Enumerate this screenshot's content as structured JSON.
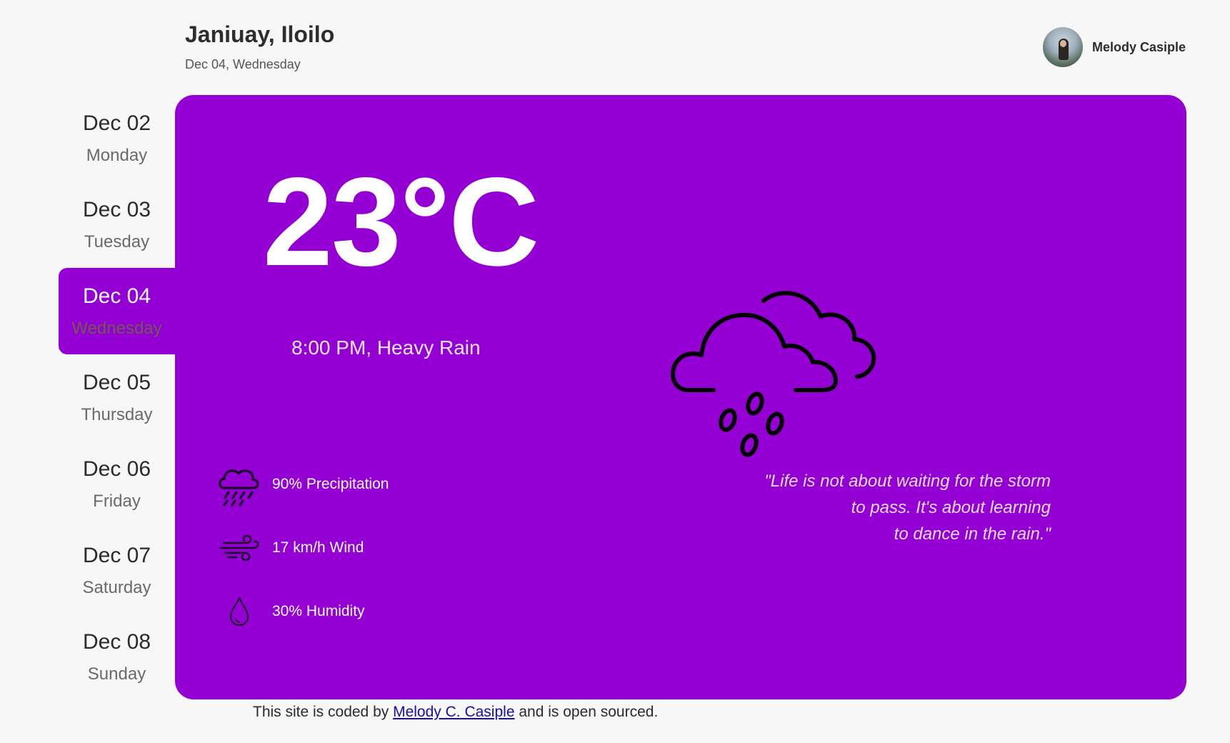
{
  "header": {
    "location": "Janiuay, Iloilo",
    "date": "Dec 04, Wednesday"
  },
  "user": {
    "name": "Melody Casiple"
  },
  "days": [
    {
      "date": "Dec 02",
      "weekday": "Monday",
      "active": false
    },
    {
      "date": "Dec 03",
      "weekday": "Tuesday",
      "active": false
    },
    {
      "date": "Dec 04",
      "weekday": "Wednesday",
      "active": true
    },
    {
      "date": "Dec 05",
      "weekday": "Thursday",
      "active": false
    },
    {
      "date": "Dec 06",
      "weekday": "Friday",
      "active": false
    },
    {
      "date": "Dec 07",
      "weekday": "Saturday",
      "active": false
    },
    {
      "date": "Dec 08",
      "weekday": "Sunday",
      "active": false
    }
  ],
  "weather": {
    "temperature": "23°C",
    "condition": "8:00 PM, Heavy Rain",
    "icon": "heavy-rain-cloud-icon",
    "stats": [
      {
        "icon": "rain-cloud-icon",
        "text": "90% Precipitation"
      },
      {
        "icon": "wind-icon",
        "text": "17 km/h Wind"
      },
      {
        "icon": "droplet-icon",
        "text": "30% Humidity"
      }
    ],
    "quote_lines": [
      "\"Life is not about waiting for the storm",
      "to pass. It's about learning",
      "to dance in the rain.\""
    ]
  },
  "footer": {
    "prefix": "This site is coded by ",
    "link_text": "Melody C. Casiple",
    "suffix": " and is open sourced."
  },
  "colors": {
    "accent": "#9400d3",
    "background": "#f7f7f7",
    "link": "#1a0dab"
  }
}
